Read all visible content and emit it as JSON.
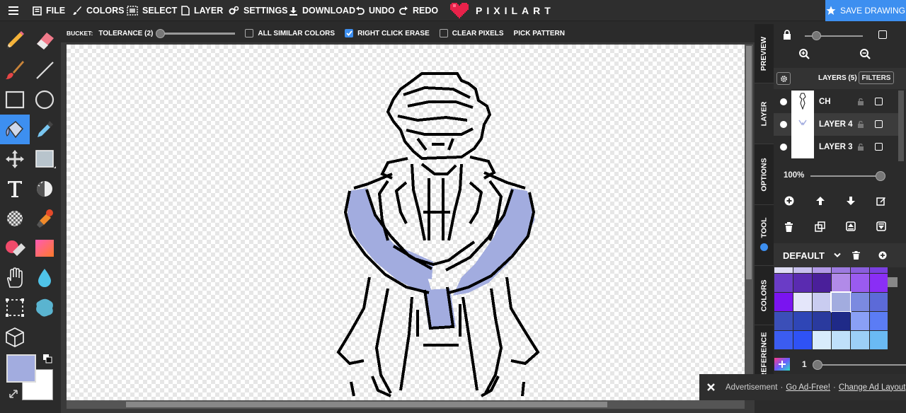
{
  "menu": {
    "items": [
      {
        "id": "file",
        "label": "FILE",
        "icon": "file-icon"
      },
      {
        "id": "colors",
        "label": "COLORS",
        "icon": "brush-icon"
      },
      {
        "id": "select",
        "label": "SELECT",
        "icon": "select-icon"
      },
      {
        "id": "layer",
        "label": "LAYER",
        "icon": "layer-icon"
      },
      {
        "id": "settings",
        "label": "SETTINGS",
        "icon": "gears-icon"
      },
      {
        "id": "download",
        "label": "DOWNLOAD",
        "icon": "download-icon"
      },
      {
        "id": "undo",
        "label": "UNDO",
        "icon": "undo-icon"
      },
      {
        "id": "redo",
        "label": "REDO",
        "icon": "redo-icon"
      }
    ],
    "logo_text": "PIXILART",
    "save_label": "SAVE DRAWING"
  },
  "tool_options": {
    "bucket_label": "BUCKET:",
    "tolerance_label": "TOLERANCE (2)",
    "tolerance_value": 2,
    "all_similar_label": "ALL SIMILAR COLORS",
    "all_similar_checked": false,
    "right_click_erase_label": "RIGHT CLICK ERASE",
    "right_click_erase_checked": true,
    "clear_pixels_label": "CLEAR PIXELS",
    "clear_pixels_checked": false,
    "pick_pattern_label": "PICK PATTERN"
  },
  "colors": {
    "primary": "#a2acdf",
    "secondary": "#ffffff",
    "accent": "#3d8ff0"
  },
  "side_tabs": [
    "PREVIEW",
    "LAYER",
    "OPTIONS",
    "TOOL",
    "COLORS",
    "REFERENCE"
  ],
  "layers": {
    "header": "LAYERS (5)",
    "filters_label": "FILTERS",
    "items": [
      {
        "name": "CH",
        "selected": false
      },
      {
        "name": "LAYER 4",
        "selected": true
      },
      {
        "name": "LAYER 3",
        "selected": false
      }
    ],
    "opacity_label": "100%"
  },
  "palette": {
    "name": "DEFAULT",
    "swatches": [
      "#e0dff5",
      "#c8c0ee",
      "#b39ae8",
      "#9d7ae0",
      "#8a5edd",
      "#7a3fe0",
      "#6a3cc6",
      "#5a2bb0",
      "#4a1f9a",
      "#b18ae8",
      "#9a5bf0",
      "#8a2ef5",
      "#7a14f0",
      "#e4e6fa",
      "#c9ccf0",
      "#a2acdf",
      "#7b8ae0",
      "#5c6ad8",
      "#3b4fb8",
      "#2f46b6",
      "#2a3a9e",
      "#1f2a88",
      "#8aa0f5",
      "#5b7cf5",
      "#3b5cf0",
      "#2f52f5",
      "#d8ecfc",
      "#bfe0fa",
      "#9ccff7",
      "#6abaf3"
    ],
    "brush_size": "1"
  },
  "ad": {
    "label": "Advertisement",
    "go_ad_free": "Go Ad-Free!",
    "change_layout": "Change Ad Layout"
  }
}
